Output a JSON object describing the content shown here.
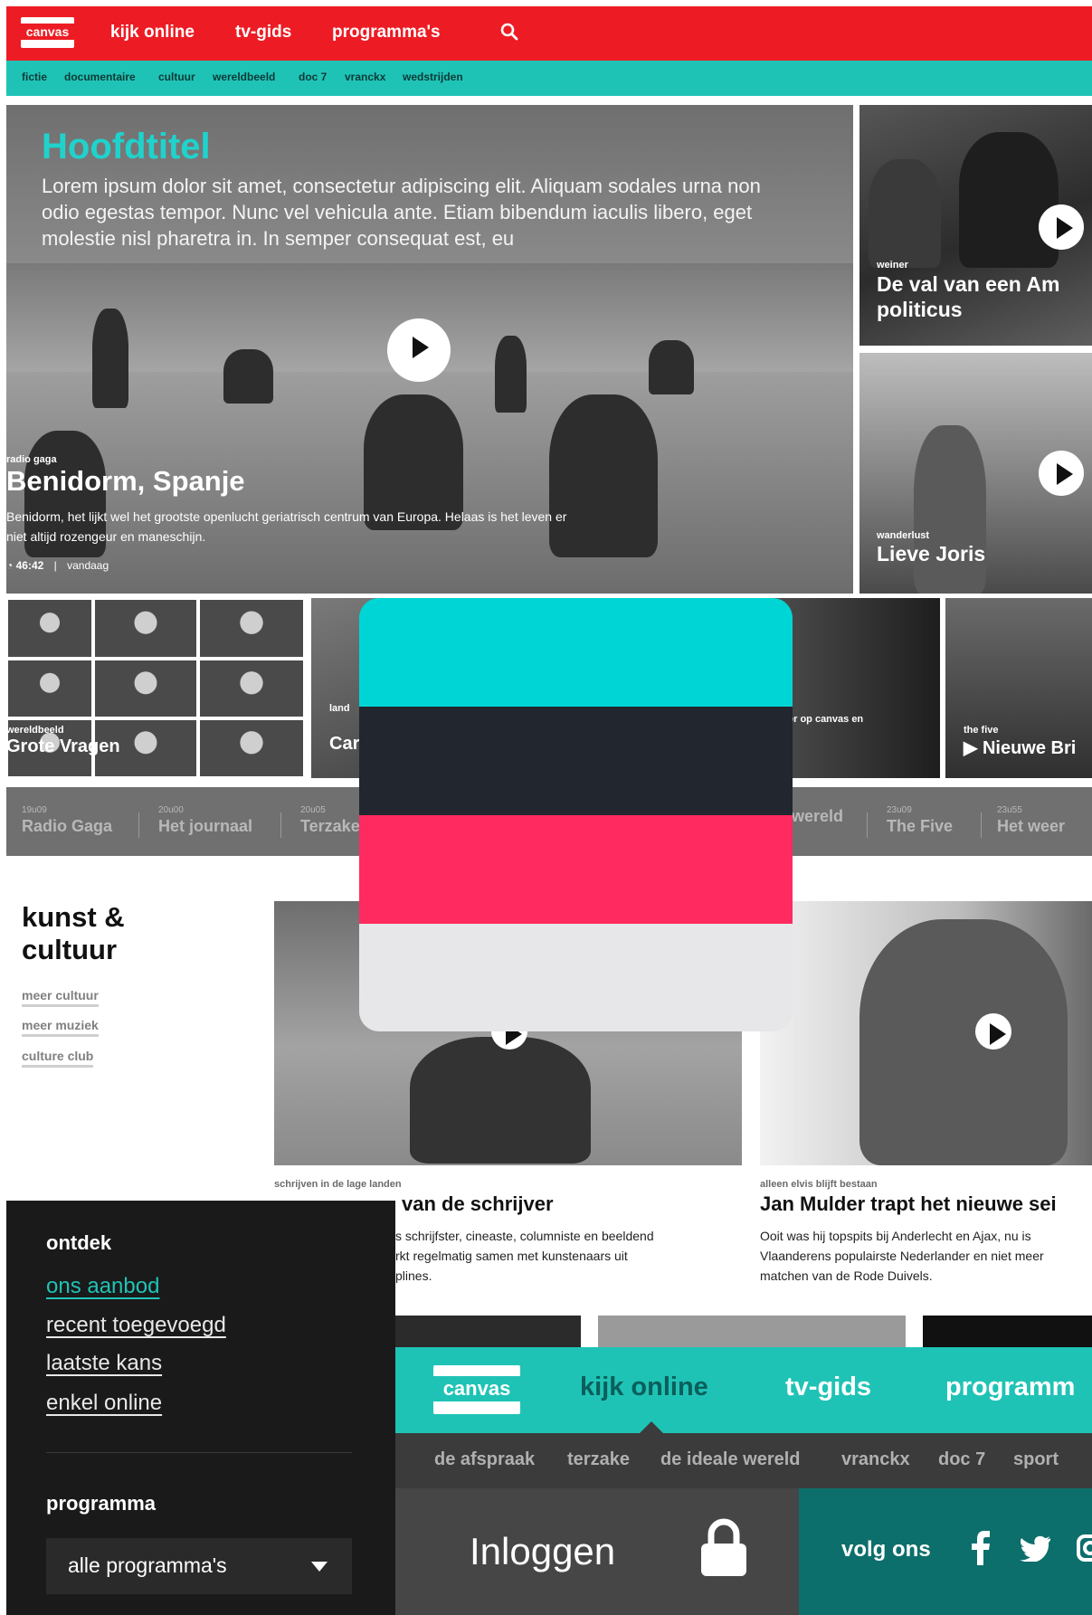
{
  "header": {
    "logo_text": "canvas",
    "nav": [
      "kijk online",
      "tv-gids",
      "programma's"
    ],
    "search_icon": "search-icon",
    "brand_color": "#ed1c24"
  },
  "subnav": [
    "fictie",
    "documentaire",
    "cultuur",
    "wereldbeeld",
    "doc 7",
    "vranckx",
    "wedstrijden"
  ],
  "hero": {
    "heading": "Hoofdtitel",
    "lorem": "Lorem ipsum dolor sit amet, consectetur adipiscing elit. Aliquam sodales urna non odio egestas tempor. Nunc vel vehicula ante. Etiam bibendum iaculis libero, eget molestie nisl pharetra in. In semper consequat est, eu",
    "kicker": "radio gaga",
    "title": "Benidorm, Spanje",
    "description": "Benidorm, het lijkt wel het grootste openlucht geriatrisch centrum van Europa. Helaas is het leven er niet altijd rozengeur en maneschijn.",
    "duration": "46:42",
    "separator": "|",
    "when": "vandaag",
    "accent": "#1fd3cc"
  },
  "side_cards": [
    {
      "kicker": "weiner",
      "title": "De val van een Am politicus"
    },
    {
      "kicker": "wanderlust",
      "title": "Lieve Joris"
    }
  ],
  "thumbs": [
    {
      "kicker": "wereldbeeld",
      "title": "Grote Vragen"
    },
    {
      "kicker": "land",
      "title": "Car"
    },
    {
      "kicker": "er op canvas en",
      "title": ""
    },
    {
      "kicker": "the five",
      "title": "Nieuwe Bri"
    }
  ],
  "tvguide": [
    {
      "time": "19u09",
      "program": "Radio Gaga"
    },
    {
      "time": "20u00",
      "program": "Het journaal"
    },
    {
      "time": "20u05",
      "program": "Terzake"
    },
    {
      "time": "",
      "program": "wereld"
    },
    {
      "time": "23u09",
      "program": "The Five"
    },
    {
      "time": "23u55",
      "program": "Het weer"
    }
  ],
  "kunst": {
    "title_line1": "kunst &",
    "title_line2": "cultuur",
    "links": [
      "meer cultuur",
      "meer muziek",
      "culture club"
    ]
  },
  "cards": [
    {
      "kicker": "schrijven in de lage landen",
      "title": "van de schrijver",
      "desc_lines": [
        "s schrijfster, cineaste, columniste en beeldend",
        "rkt regelmatig samen met kunstenaars uit",
        "plines."
      ]
    },
    {
      "kicker": "alleen elvis blijft bestaan",
      "title": "Jan Mulder trapt het nieuwe sei",
      "desc_lines": [
        "Ooit was hij topspits bij Anderlecht en Ajax, nu is",
        "Vlaanderens populairste Nederlander en niet meer",
        "matchen van de Rode Duivels."
      ]
    }
  ],
  "palette": [
    "#00d5d5",
    "#22262f",
    "#ff2a5f",
    "#e7e7e9"
  ],
  "menu": {
    "ontdek_heading": "ontdek",
    "links": [
      "ons aanbod",
      "recent toegevoegd",
      "laatste kans",
      "enkel online"
    ],
    "active_link_color": "#1fc3b6",
    "programma_heading": "programma",
    "select_value": "alle programma's"
  },
  "nav2": {
    "logo_text": "canvas",
    "items": [
      "kijk online",
      "tv-gids",
      "programm"
    ],
    "sub": [
      "de afspraak",
      "terzake",
      "de ideale wereld",
      "vranckx",
      "doc 7",
      "sport"
    ]
  },
  "footer": {
    "login": "Inloggen",
    "follow": "volg ons",
    "social_icons": [
      "facebook-icon",
      "twitter-icon",
      "instagram-icon"
    ]
  }
}
